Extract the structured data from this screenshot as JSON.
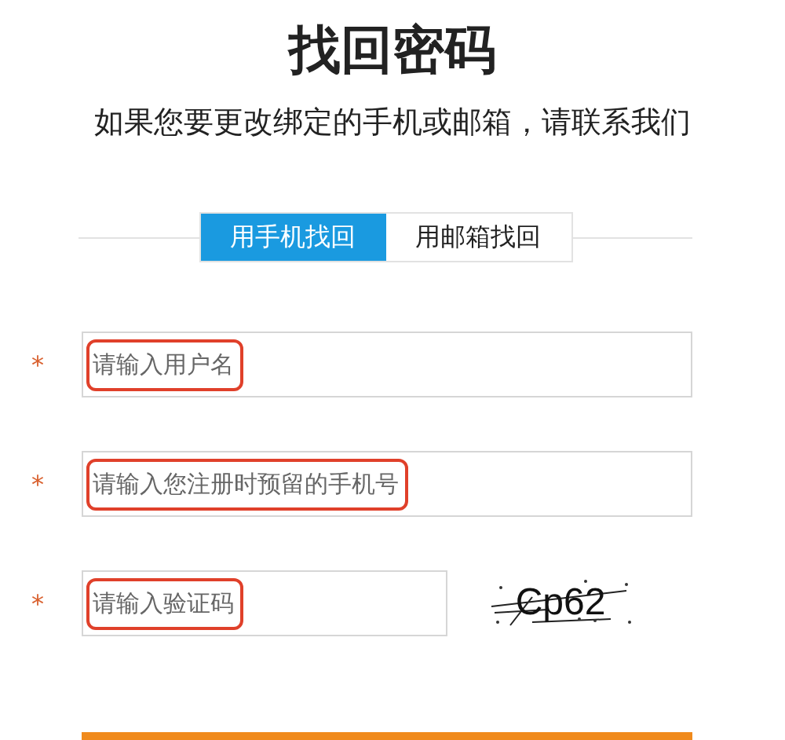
{
  "title": "找回密码",
  "subtitle": "如果您要更改绑定的手机或邮箱，请联系我们",
  "tabs": [
    {
      "label": "用手机找回",
      "selected": true
    },
    {
      "label": "用邮箱找回",
      "selected": false
    }
  ],
  "fields": [
    {
      "required_mark": "*",
      "placeholder": "请输入用户名",
      "highlighted": true,
      "kind": "text"
    },
    {
      "required_mark": "*",
      "placeholder": "请输入您注册时预留的手机号",
      "highlighted": true,
      "kind": "text"
    },
    {
      "required_mark": "*",
      "placeholder": "请输入验证码",
      "highlighted": true,
      "kind": "captcha",
      "captcha": "Cp62"
    }
  ]
}
